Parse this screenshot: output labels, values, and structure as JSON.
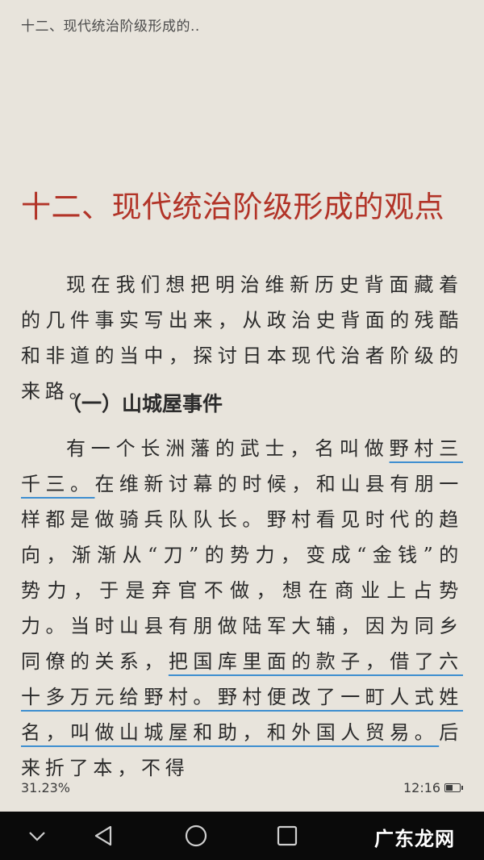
{
  "header": {
    "title": "十二、现代统治阶级形成的.."
  },
  "chapter": {
    "title": "十二、现代统治阶级形成的观点"
  },
  "content": {
    "paragraph1": "现在我们想把明治维新历史背面藏着的几件事实写出来，从政治史背面的残酷和非道的当中，探讨日本现代治者阶级的来路。",
    "section_title": "（一）山城屋事件",
    "p2": {
      "s1": "有一个长洲藩的武士，名叫做",
      "s2": "野村三千三。",
      "s3": "在维新讨幕的时候，和山县有朋一样都是做骑兵队队长。野村看见时代的趋向，渐渐从“刀”的势力，变成“金钱”的势力，于是弃官不做，想在商业上占势力。当时山县有朋做陆军大辅，因为同乡同僚的关系，",
      "s4": "把国库里面的款子，借了六十多万元给野村。野村便改了一町人式姓名，叫做山城屋和助，和外国人贸易。",
      "s5": "后来折了本，不得"
    }
  },
  "status": {
    "progress": "31.23%",
    "time": "12:16",
    "battery_level": 0.5
  },
  "navbar": {
    "buttons": [
      "chevron-down-icon",
      "back-icon",
      "home-icon",
      "recents-icon"
    ],
    "watermark": "广东龙网"
  },
  "colors": {
    "background": "#e8e4dc",
    "title_red": "#b23428",
    "underline_blue": "#3d8ed0",
    "navbar": "#0a0a0a"
  }
}
